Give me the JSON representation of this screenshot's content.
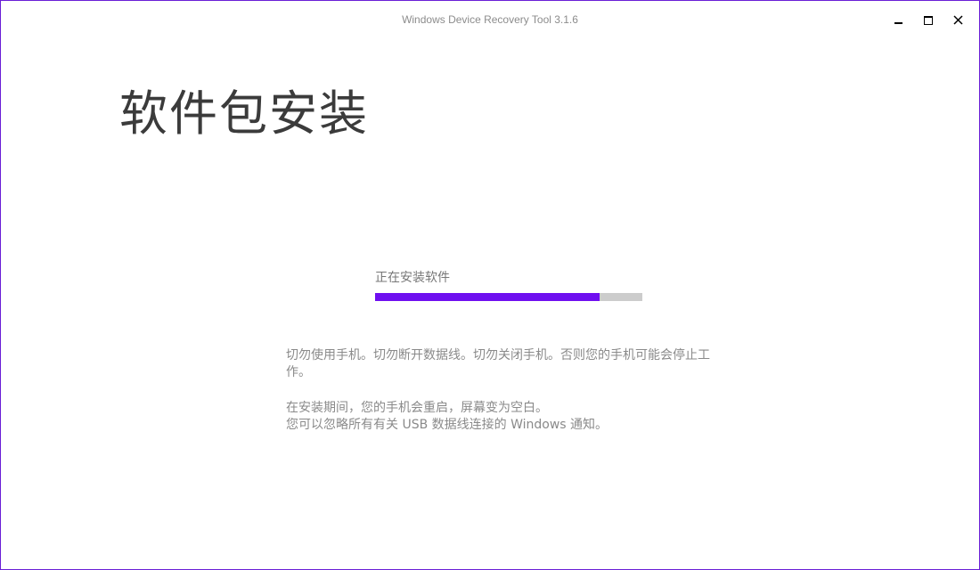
{
  "window": {
    "title": "Windows Device Recovery Tool 3.1.6",
    "accent_color": "#6f0ff0",
    "buttons": {
      "minimize": "minimize-icon",
      "maximize": "maximize-icon",
      "close": "close-icon"
    }
  },
  "page": {
    "title": "软件包安装"
  },
  "progress": {
    "label": "正在安装软件",
    "fraction": 0.84,
    "fill_color": "#6f0ff0",
    "track_color": "#cccccc"
  },
  "info": {
    "paragraph1": "切勿使用手机。切勿断开数据线。切勿关闭手机。否则您的手机可能会停止工作。",
    "paragraph2_line1": "在安装期间，您的手机会重启，屏幕变为空白。",
    "paragraph2_line2": "您可以忽略所有有关 USB 数据线连接的 Windows 通知。"
  }
}
